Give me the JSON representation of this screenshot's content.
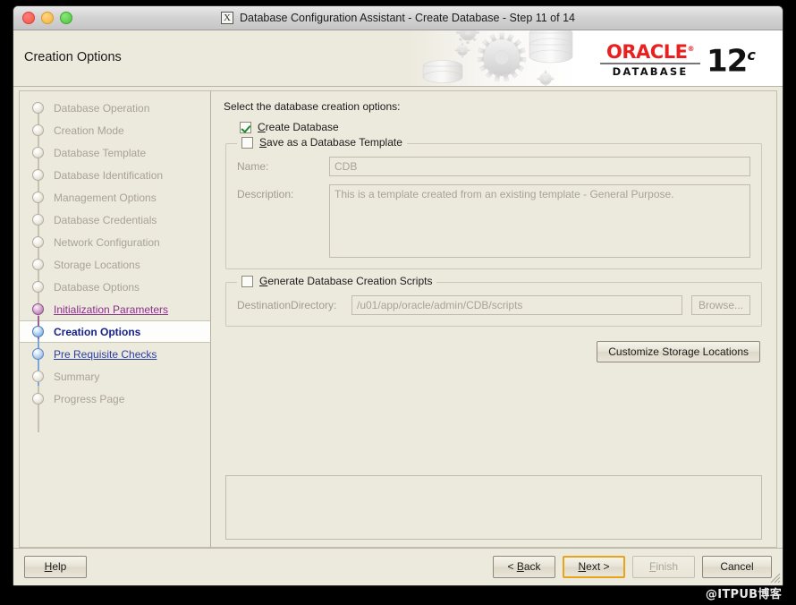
{
  "window": {
    "title": "Database Configuration Assistant - Create Database - Step 11 of 14",
    "app_icon_glyph": "X",
    "banner_title": "Creation Options"
  },
  "logo": {
    "brand": "ORACLE",
    "trademark": "®",
    "product": "DATABASE",
    "version_number": "12",
    "version_suffix": "c"
  },
  "sidebar": {
    "items": [
      {
        "label": "Database Operation",
        "state": "done"
      },
      {
        "label": "Creation Mode",
        "state": "done"
      },
      {
        "label": "Database Template",
        "state": "done"
      },
      {
        "label": "Database Identification",
        "state": "done"
      },
      {
        "label": "Management Options",
        "state": "done"
      },
      {
        "label": "Database Credentials",
        "state": "done"
      },
      {
        "label": "Network Configuration",
        "state": "done"
      },
      {
        "label": "Storage Locations",
        "state": "done"
      },
      {
        "label": "Database Options",
        "state": "done"
      },
      {
        "label": "Initialization Parameters",
        "state": "visited"
      },
      {
        "label": "Creation Options",
        "state": "current"
      },
      {
        "label": "Pre Requisite Checks",
        "state": "visited2"
      },
      {
        "label": "Summary",
        "state": "done"
      },
      {
        "label": "Progress Page",
        "state": "done"
      }
    ]
  },
  "main": {
    "intro": "Select the database creation options:",
    "create_database": {
      "label": "Create Database",
      "underline_char": "C",
      "checked": true
    },
    "save_template": {
      "label": "Save as a Database Template",
      "underline_char": "S",
      "checked": false,
      "name_label": "Name:",
      "name_value": "CDB",
      "description_label": "Description:",
      "description_value": "This is a template created from an existing template - General Purpose."
    },
    "generate_scripts": {
      "label": "Generate Database Creation Scripts",
      "underline_char": "G",
      "checked": false,
      "destination_label": "DestinationDirectory:",
      "destination_value": "/u01/app/oracle/admin/CDB/scripts",
      "browse_label": "Browse..."
    },
    "customize_button": "Customize Storage Locations",
    "message_panel_text": ""
  },
  "footer": {
    "help": "Help",
    "back": "< Back",
    "next": "Next >",
    "finish": "Finish",
    "cancel": "Cancel"
  },
  "watermark": "@ITPUB博客",
  "colors": {
    "window_bg": "#ece9dd",
    "oracle_red": "#e8201f",
    "focus_orange": "#e8a317",
    "current_step": "#16228a",
    "visited_link": "#8d2f8d",
    "visited_link_blue": "#2b3fa0",
    "disabled_text": "#a8a396",
    "check_green": "#1e8a2e"
  }
}
